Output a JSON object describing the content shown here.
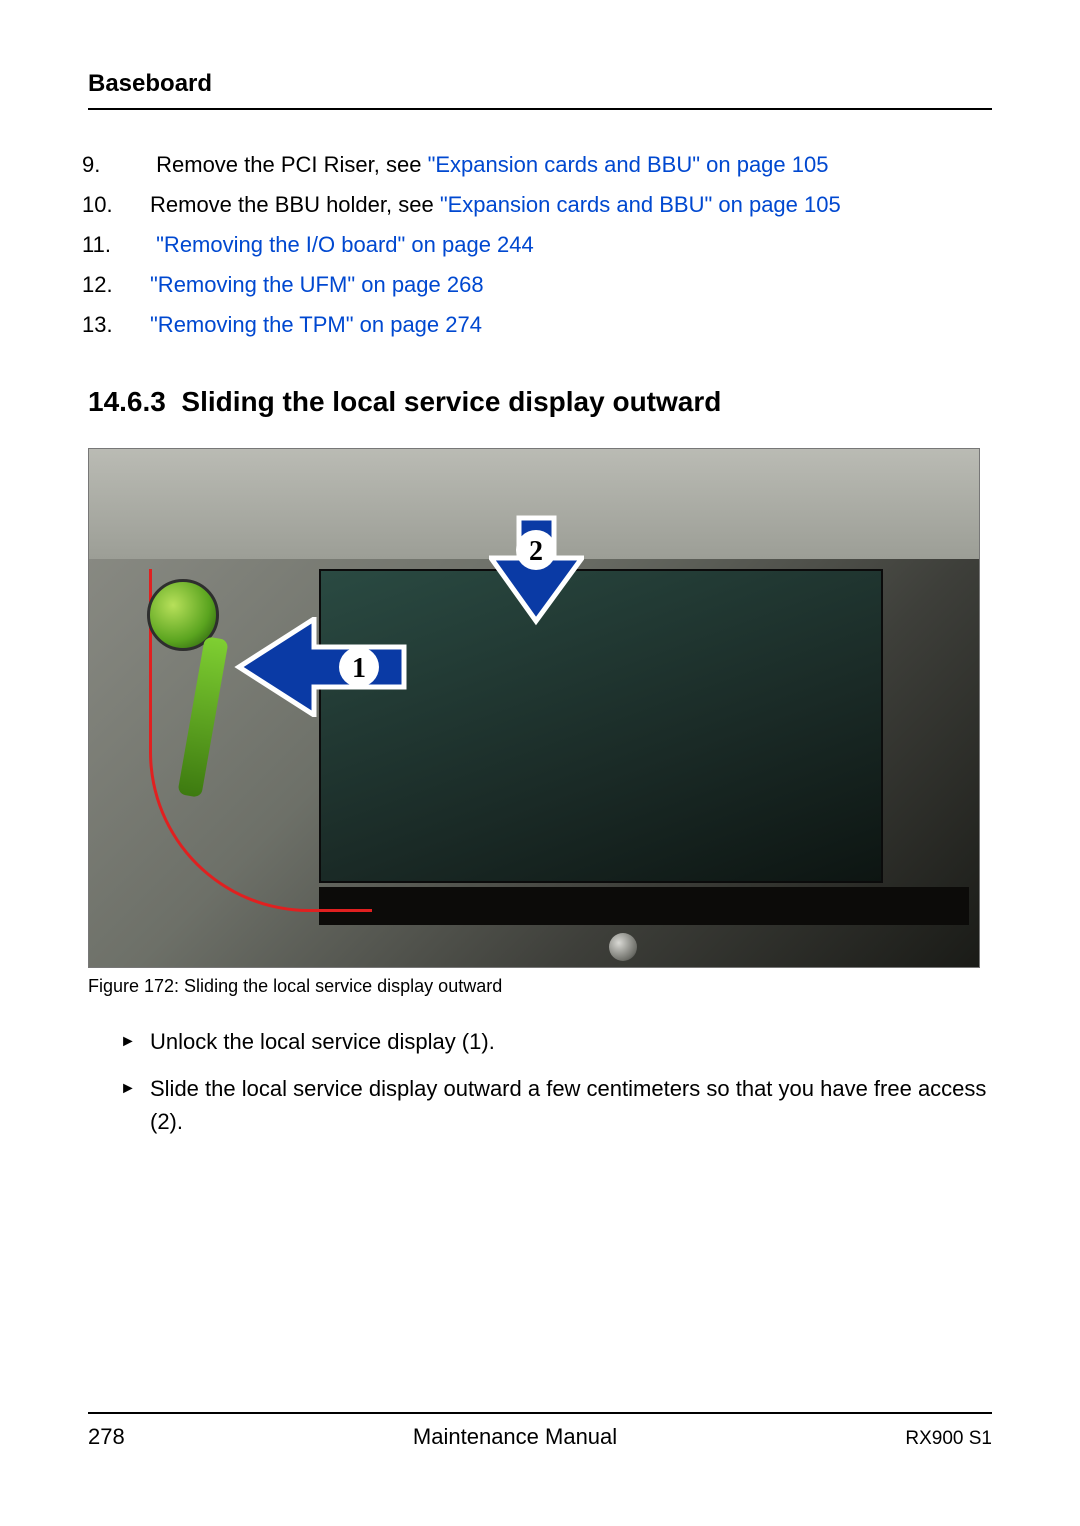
{
  "header": "Baseboard",
  "list": {
    "item9": {
      "num": "9.",
      "pre": "Remove the PCI Riser, see ",
      "link": "\"Expansion cards and BBU\" on page 105"
    },
    "item10": {
      "num": "10.",
      "pre": "Remove the BBU holder, see ",
      "link": "\"Expansion cards and BBU\" on page 105"
    },
    "item11": {
      "num": "11.",
      "pre": " ",
      "link": "\"Removing the I/O board\" on page 244"
    },
    "item12": {
      "num": "12.",
      "pre": "",
      "link": "\"Removing the UFM\" on page 268"
    },
    "item13": {
      "num": "13.",
      "pre": "",
      "link": "\"Removing the TPM\" on page 274"
    }
  },
  "section": {
    "number": "14.6.3",
    "title": "Sliding the local service display outward"
  },
  "figure": {
    "callout1": "1",
    "callout2": "2",
    "caption": "Figure 172: Sliding the local service display outward"
  },
  "steps": {
    "s1": "Unlock the local service display (1).",
    "s2": "Slide the local service display outward a few centimeters so that you have free access (2)."
  },
  "footer": {
    "page": "278",
    "center": "Maintenance Manual",
    "right": "RX900 S1"
  }
}
